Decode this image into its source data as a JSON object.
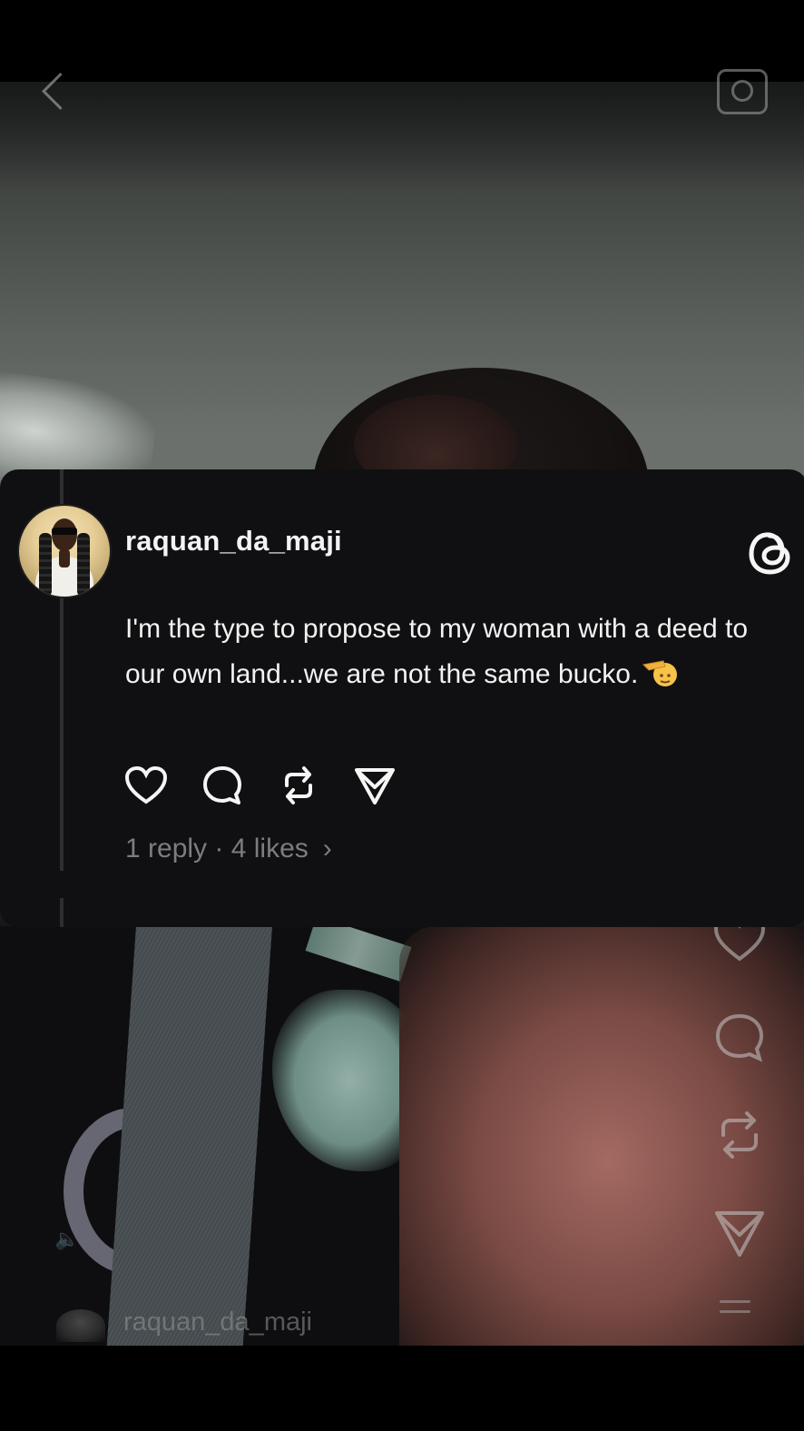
{
  "background": {
    "handle": "raquan_da_maji",
    "icons": {
      "back": "chevron-left-icon",
      "camera": "camera-icon",
      "like": "heart-icon",
      "comment": "comment-icon",
      "repost": "repost-icon",
      "share": "send-icon",
      "menu": "menu-icon"
    }
  },
  "post": {
    "username": "raquan_da_maji",
    "text": "I'm the type to propose to my woman with a deed to our own land...we are not the same bucko.",
    "emoji_icon": "saluting-face-emoji",
    "replies_text": "1 reply",
    "separator": " · ",
    "likes_text": "4 likes",
    "chevron": "›",
    "icons": {
      "like": "heart-icon",
      "reply": "comment-icon",
      "repost": "repost-icon",
      "share": "send-icon",
      "brand": "threads-logo-icon"
    }
  },
  "colors": {
    "card_bg": "#101012",
    "text_primary": "#f3f3f3",
    "text_secondary": "#7d7d80"
  }
}
